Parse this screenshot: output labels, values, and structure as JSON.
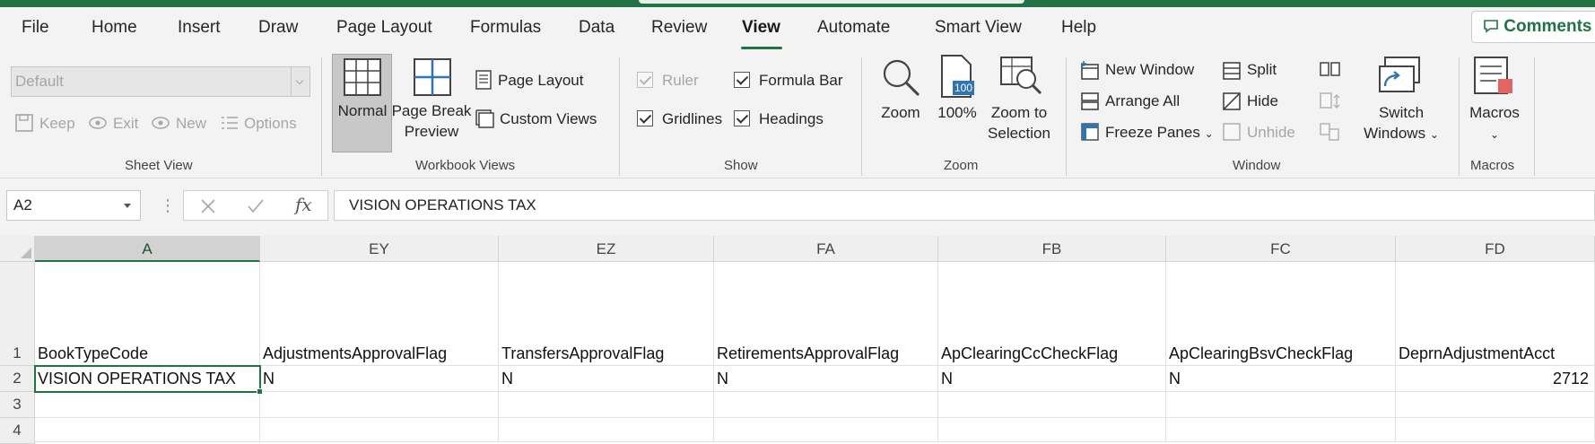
{
  "menu": {
    "tabs": [
      "File",
      "Home",
      "Insert",
      "Draw",
      "Page Layout",
      "Formulas",
      "Data",
      "Review",
      "View",
      "Automate",
      "Smart View",
      "Help"
    ],
    "active_tab": "View",
    "comments_label": "Comments"
  },
  "ribbon": {
    "sheet_view": {
      "label": "Sheet View",
      "dropdown_value": "Default",
      "keep": "Keep",
      "exit": "Exit",
      "new": "New",
      "options": "Options"
    },
    "workbook_views": {
      "label": "Workbook Views",
      "normal": "Normal",
      "page_break_1": "Page Break",
      "page_break_2": "Preview",
      "page_layout": "Page Layout",
      "custom_views": "Custom Views"
    },
    "show": {
      "label": "Show",
      "ruler": "Ruler",
      "formula_bar": "Formula Bar",
      "gridlines": "Gridlines",
      "headings": "Headings"
    },
    "zoom": {
      "label": "Zoom",
      "zoom": "Zoom",
      "hundred": "100%",
      "hundred_icon": "100",
      "zoom_to_1": "Zoom to",
      "zoom_to_2": "Selection"
    },
    "window": {
      "label": "Window",
      "new_window": "New Window",
      "arrange_all": "Arrange All",
      "freeze_panes": "Freeze Panes",
      "split": "Split",
      "hide": "Hide",
      "unhide": "Unhide",
      "switch_1": "Switch",
      "switch_2": "Windows"
    },
    "macros": {
      "label": "Macros",
      "macros": "Macros"
    }
  },
  "formula_bar": {
    "name_box": "A2",
    "fx": "fx",
    "value": "VISION OPERATIONS TAX"
  },
  "sheet": {
    "columns": [
      "A",
      "EY",
      "EZ",
      "FA",
      "FB",
      "FC",
      "FD"
    ],
    "row_numbers": [
      "1",
      "2",
      "3",
      "4"
    ],
    "rows": [
      [
        "BookTypeCode",
        "AdjustmentsApprovalFlag",
        "TransfersApprovalFlag",
        "RetirementsApprovalFlag",
        "ApClearingCcCheckFlag",
        "ApClearingBsvCheckFlag",
        "DeprnAdjustmentAcct"
      ],
      [
        "VISION OPERATIONS TAX",
        "N",
        "N",
        "N",
        "N",
        "N",
        "2712"
      ],
      [
        "",
        "",
        "",
        "",
        "",
        "",
        ""
      ],
      [
        "",
        "",
        "",
        "",
        "",
        "",
        ""
      ]
    ]
  }
}
